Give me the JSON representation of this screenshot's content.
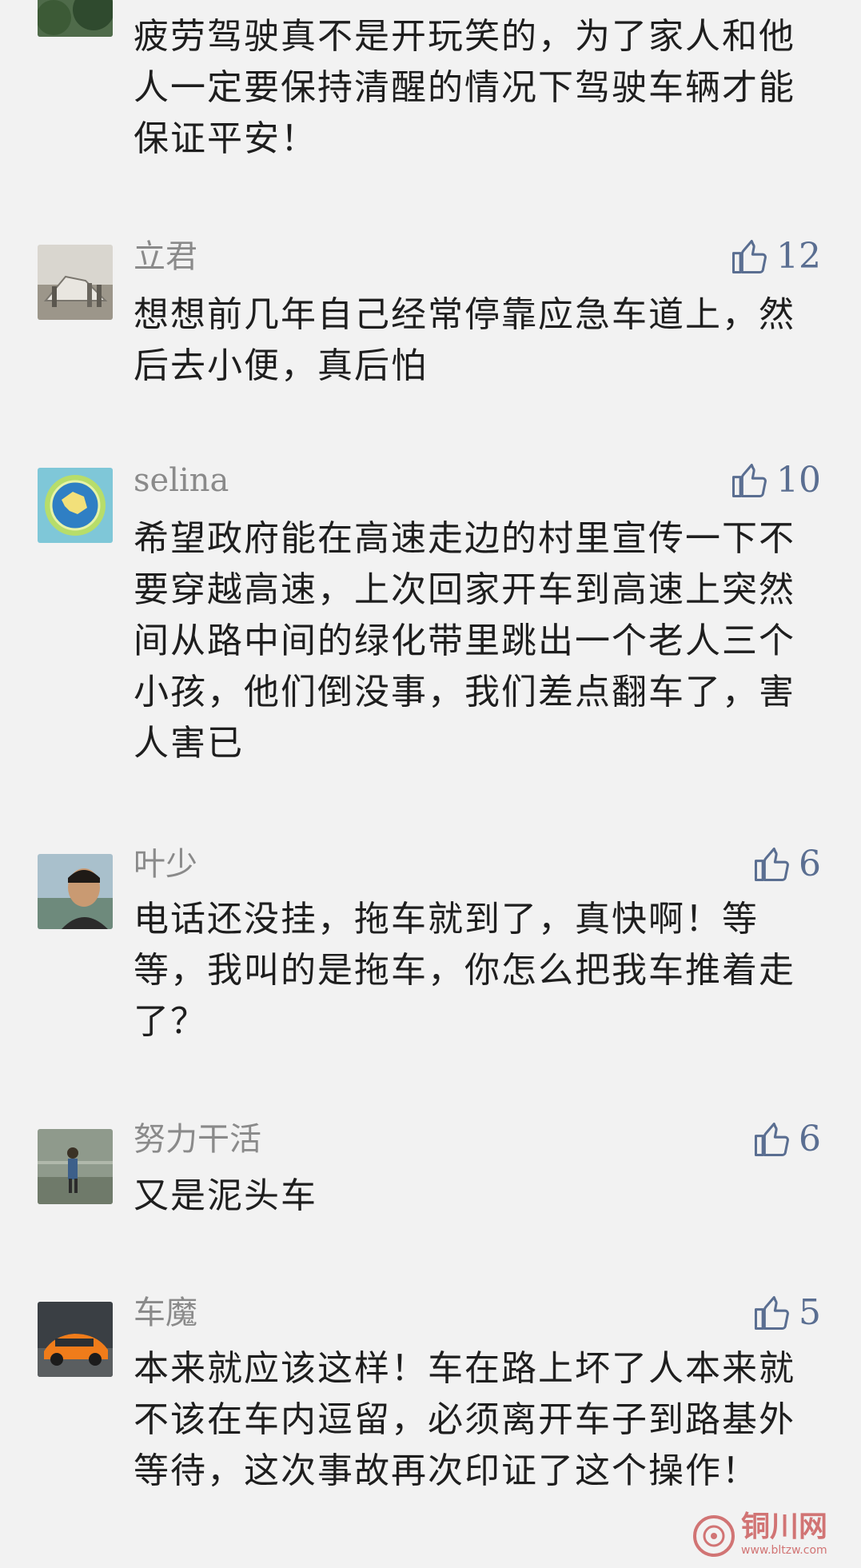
{
  "comments": [
    {
      "name": "",
      "likes": "",
      "text": "疲劳驾驶真不是开玩笑的，为了家人和他人一定要保持清醒的情况下驾驶车辆才能保证平安！"
    },
    {
      "name": "立君",
      "likes": "12",
      "text": "想想前几年自己经常停靠应急车道上，然后去小便，真后怕"
    },
    {
      "name": "selina",
      "likes": "10",
      "text": "希望政府能在高速走边的村里宣传一下不要穿越高速，上次回家开车到高速上突然间从路中间的绿化带里跳出一个老人三个小孩，他们倒没事，我们差点翻车了，害人害已"
    },
    {
      "name": "叶少",
      "likes": "6",
      "text": "电话还没挂，拖车就到了，真快啊！等等，我叫的是拖车，你怎么把我车推着走了？"
    },
    {
      "name": "努力干活",
      "likes": "6",
      "text": "又是泥头车"
    },
    {
      "name": "车魔",
      "likes": "5",
      "text": "本来就应该这样！车在路上坏了人本来就不该在车内逗留，必须离开车子到路基外等待，这次事故再次印证了这个操作！"
    }
  ],
  "watermark": {
    "title": "铜川网",
    "url": "www.bltzw.com"
  },
  "colors": {
    "background": "#f2f2f2",
    "like": "#5a6e91",
    "name": "#8a8a8a",
    "text": "#1e1e1e"
  },
  "icons": {
    "like": "thumbs-up-icon"
  }
}
